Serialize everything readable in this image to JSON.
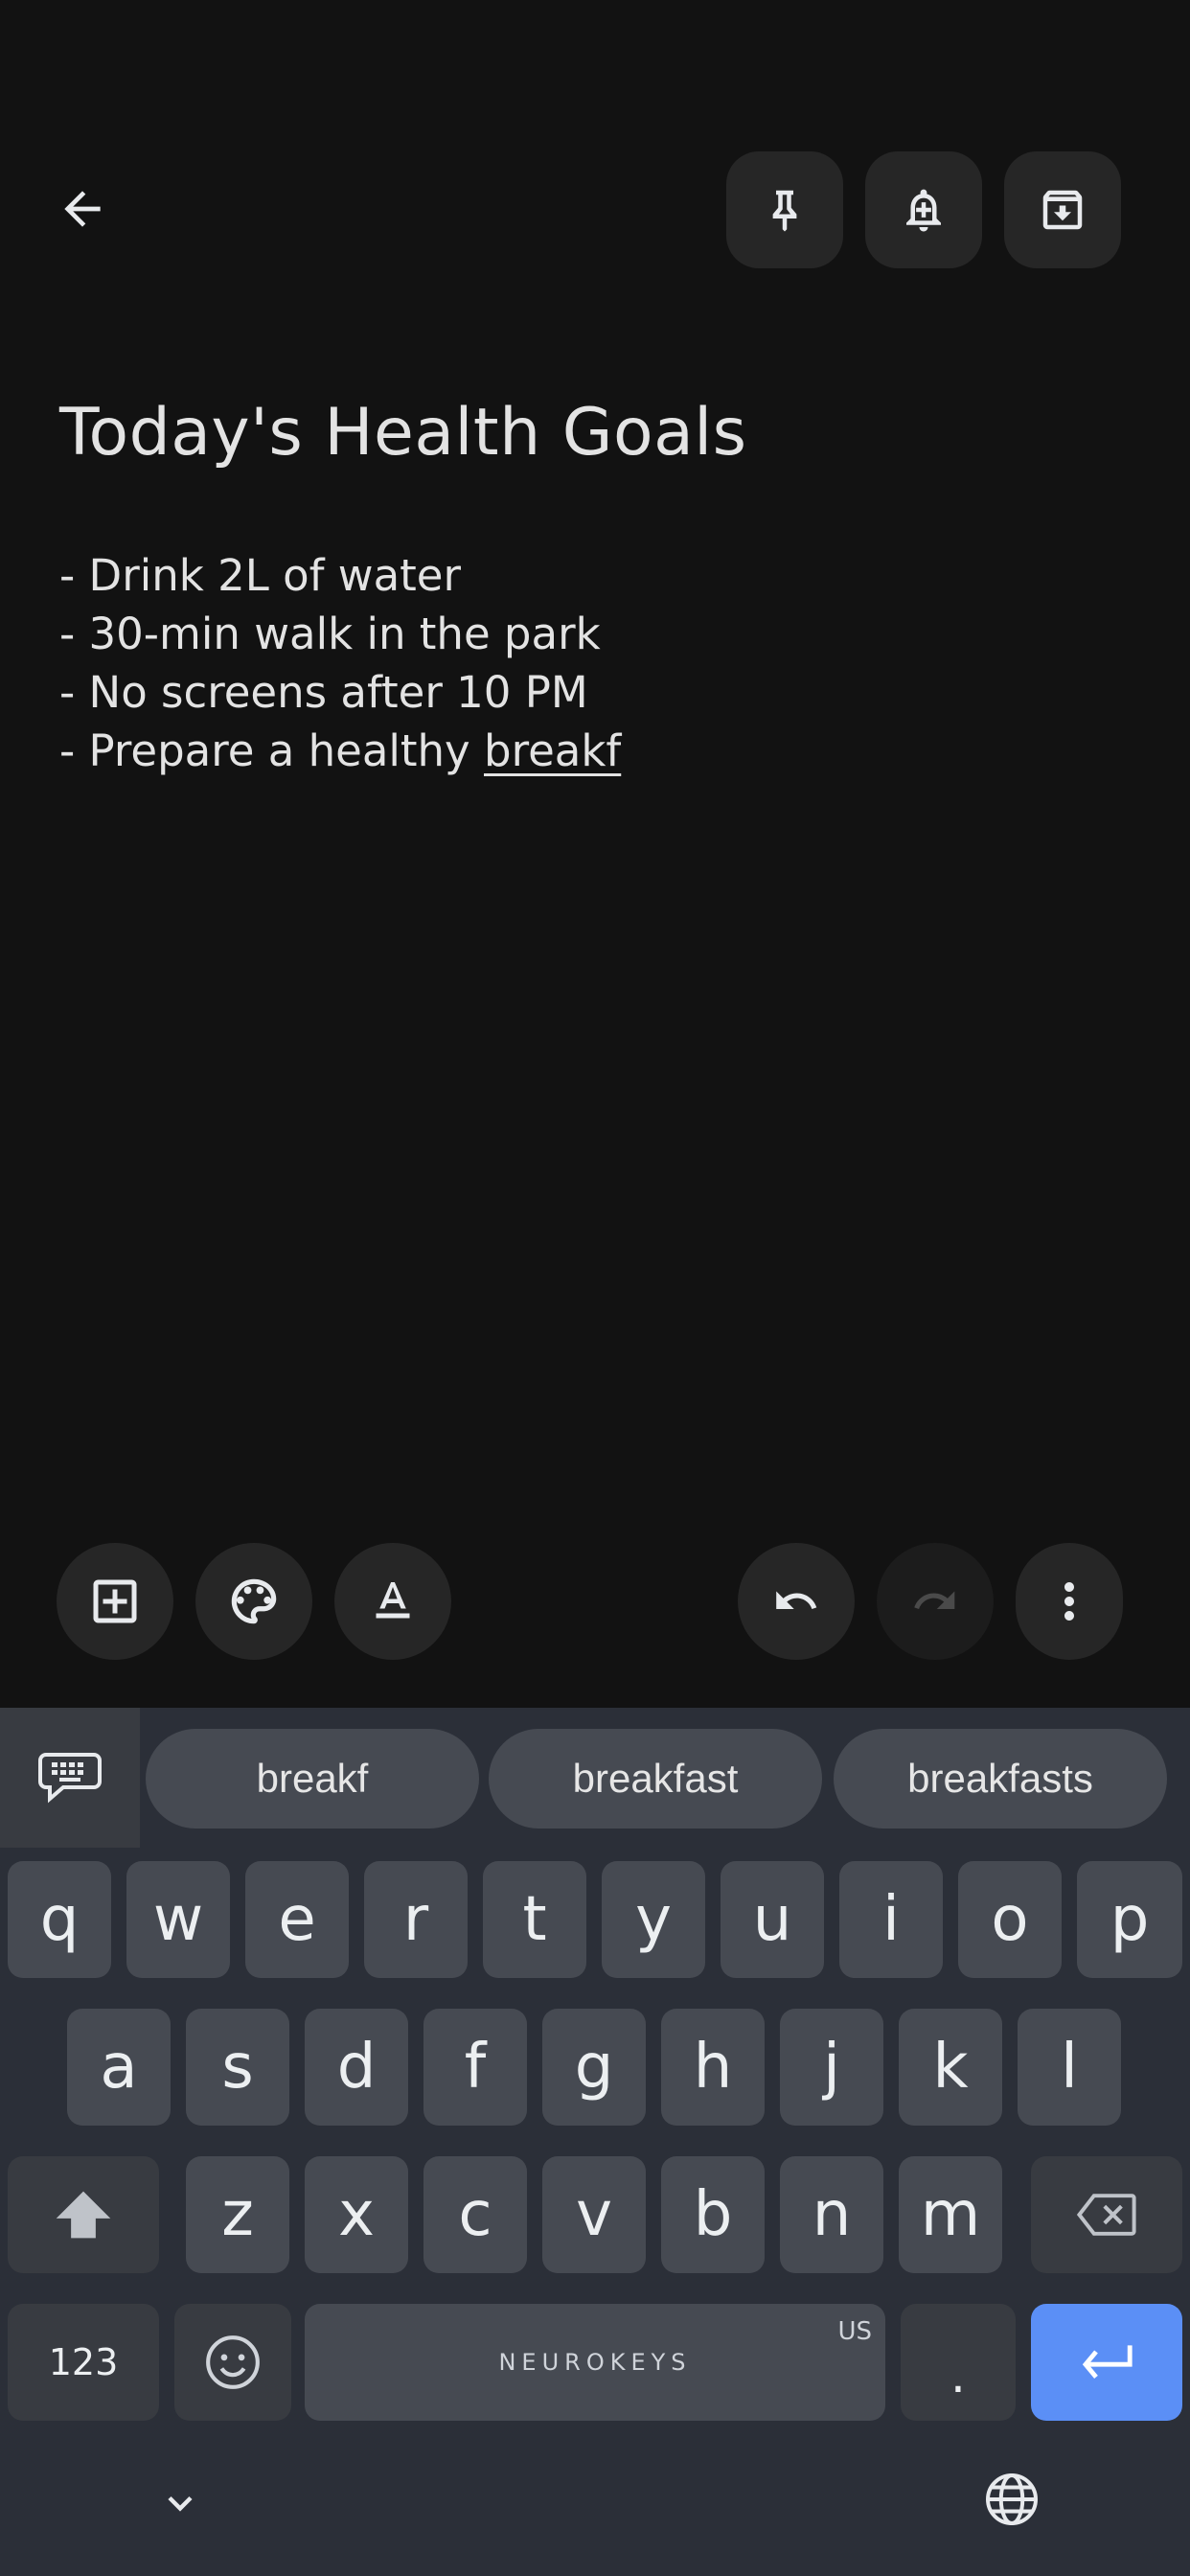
{
  "note": {
    "title": "Today's Health Goals",
    "lines": [
      "- Drink 2L of water",
      "- 30-min walk in the park",
      "- No screens after 10 PM",
      "- Prepare a healthy "
    ],
    "current_word": "breakf"
  },
  "suggestions": [
    "breakf",
    "breakfast",
    "breakfasts"
  ],
  "keyboard": {
    "row1": [
      "q",
      "w",
      "e",
      "r",
      "t",
      "y",
      "u",
      "i",
      "o",
      "p"
    ],
    "row2": [
      "a",
      "s",
      "d",
      "f",
      "g",
      "h",
      "j",
      "k",
      "l"
    ],
    "row3": [
      "z",
      "x",
      "c",
      "v",
      "b",
      "n",
      "m"
    ],
    "numbers_label": "123",
    "period_label": ".",
    "space_brand": "NEUROKEYS",
    "space_locale": "US"
  },
  "colors": {
    "background": "#121212",
    "button_bg": "#262626",
    "keyboard_bg": "#2b2f38",
    "key_bg": "#464a52",
    "enter_key": "#5b8ff6"
  },
  "icons": {
    "back": "arrow-left-icon",
    "pin": "pin-icon",
    "reminder": "bell-plus-icon",
    "archive": "archive-icon",
    "add": "add-box-icon",
    "palette": "palette-icon",
    "format": "text-format-icon",
    "undo": "undo-icon",
    "redo": "redo-icon",
    "more": "more-vert-icon"
  }
}
